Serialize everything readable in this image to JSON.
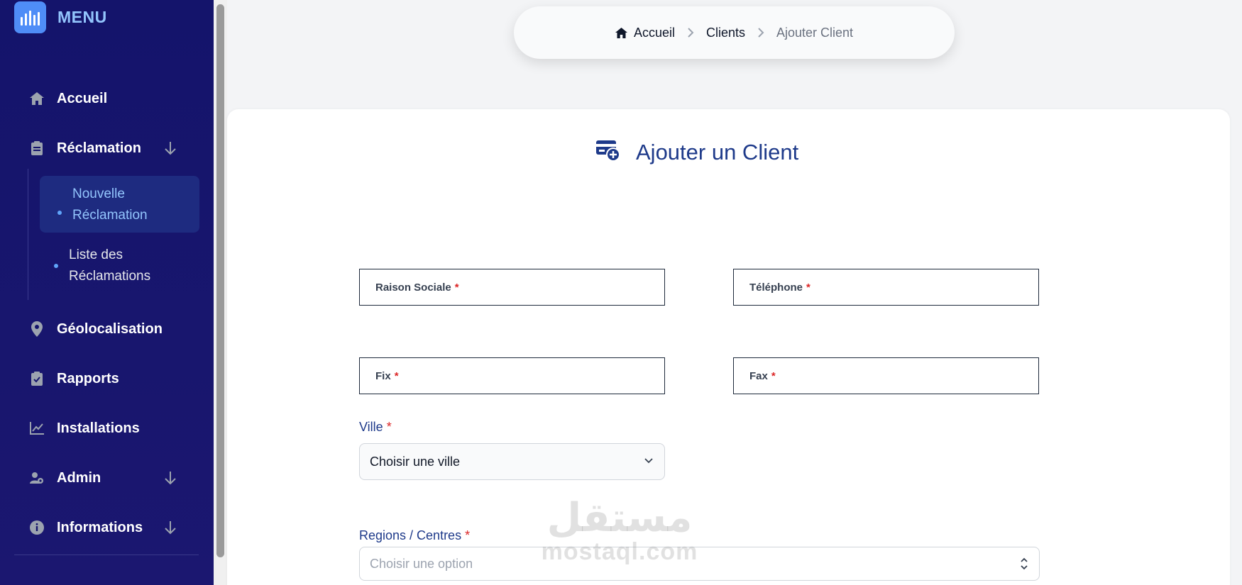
{
  "sidebar": {
    "title": "MENU",
    "items": [
      {
        "label": "Accueil",
        "icon": "home-icon"
      },
      {
        "label": "Réclamation",
        "icon": "clipboard-icon"
      },
      {
        "label": "Géolocalisation",
        "icon": "location-pin-icon"
      },
      {
        "label": "Rapports",
        "icon": "clipboard-check-icon"
      },
      {
        "label": "Installations",
        "icon": "chart-line-icon"
      },
      {
        "label": "Admin",
        "icon": "user-gear-icon"
      },
      {
        "label": "Informations",
        "icon": "info-icon"
      }
    ],
    "subitems": [
      {
        "line1": "Nouvelle",
        "line2": "Réclamation"
      },
      {
        "line1": "Liste des",
        "line2": "Réclamations"
      }
    ]
  },
  "breadcrumb": {
    "home": "Accueil",
    "parent": "Clients",
    "current": "Ajouter Client"
  },
  "form": {
    "title": "Ajouter un Client",
    "required_mark": "*",
    "fields": {
      "raison_sociale": "Raison Sociale",
      "telephone": "Téléphone",
      "fix": "Fix",
      "fax": "Fax"
    },
    "ville": {
      "label": "Ville",
      "value": "Choisir une ville"
    },
    "regions": {
      "label": "Regions / Centres",
      "placeholder": "Choisir une option"
    }
  },
  "watermark": {
    "top": "مستقل",
    "bottom": "mostaql.com"
  },
  "colors": {
    "sidebar_bg": "#14146b",
    "accent": "#1e3a8a",
    "active_sub": "#93c5fd",
    "required": "#dc2626"
  }
}
